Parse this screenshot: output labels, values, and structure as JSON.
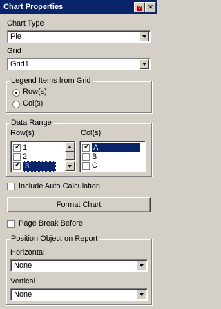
{
  "window": {
    "title": "Chart Properties"
  },
  "chart_type": {
    "label": "Chart Type",
    "value": "Pie"
  },
  "grid": {
    "label": "Grid",
    "value": "Grid1"
  },
  "legend_items": {
    "label": "Legend Items from Grid",
    "rows_label": "Row(s)",
    "cols_label": "Col(s)",
    "selected": "rows"
  },
  "data_range": {
    "label": "Data Range",
    "rows_label": "Row(s)",
    "cols_label": "Col(s)",
    "rows": [
      {
        "label": "1",
        "checked": true,
        "selected": false
      },
      {
        "label": "2",
        "checked": false,
        "selected": false
      },
      {
        "label": "3",
        "checked": true,
        "selected": true
      }
    ],
    "cols": [
      {
        "label": "A",
        "checked": true,
        "selected": true
      },
      {
        "label": "B",
        "checked": false,
        "selected": false
      },
      {
        "label": "C",
        "checked": false,
        "selected": false
      }
    ]
  },
  "include_auto_calc": {
    "label": "Include Auto Calculation",
    "checked": false
  },
  "format_chart": {
    "label": "Format Chart"
  },
  "page_break": {
    "label": "Page Break Before",
    "checked": false
  },
  "position": {
    "label": "Position Object on Report",
    "horizontal_label": "Horizontal",
    "horizontal_value": "None",
    "vertical_label": "Vertical",
    "vertical_value": "None"
  },
  "colors": {
    "titlebar": "#0a246a",
    "face": "#d4d0c8",
    "selection": "#0a246a"
  }
}
